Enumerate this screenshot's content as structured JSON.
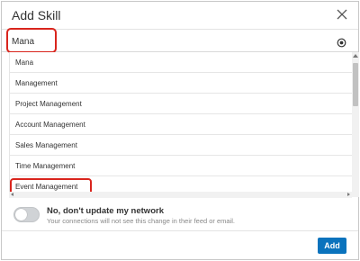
{
  "dialog": {
    "title": "Add Skill",
    "close_icon": "close-icon"
  },
  "search": {
    "value": "Mana",
    "clear_icon": "clear-target-icon"
  },
  "suggestions": [
    {
      "label": "Mana"
    },
    {
      "label": "Management"
    },
    {
      "label": "Project Management"
    },
    {
      "label": "Account Management"
    },
    {
      "label": "Sales Management"
    },
    {
      "label": "Time Management"
    },
    {
      "label": "Event Management"
    }
  ],
  "network": {
    "toggle_on": false,
    "title": "No, don't update my network",
    "description": "Your connections will not see this change in their feed or email."
  },
  "actions": {
    "add_label": "Add"
  },
  "colors": {
    "accent": "#0a73bd",
    "highlight": "#d9251d"
  }
}
